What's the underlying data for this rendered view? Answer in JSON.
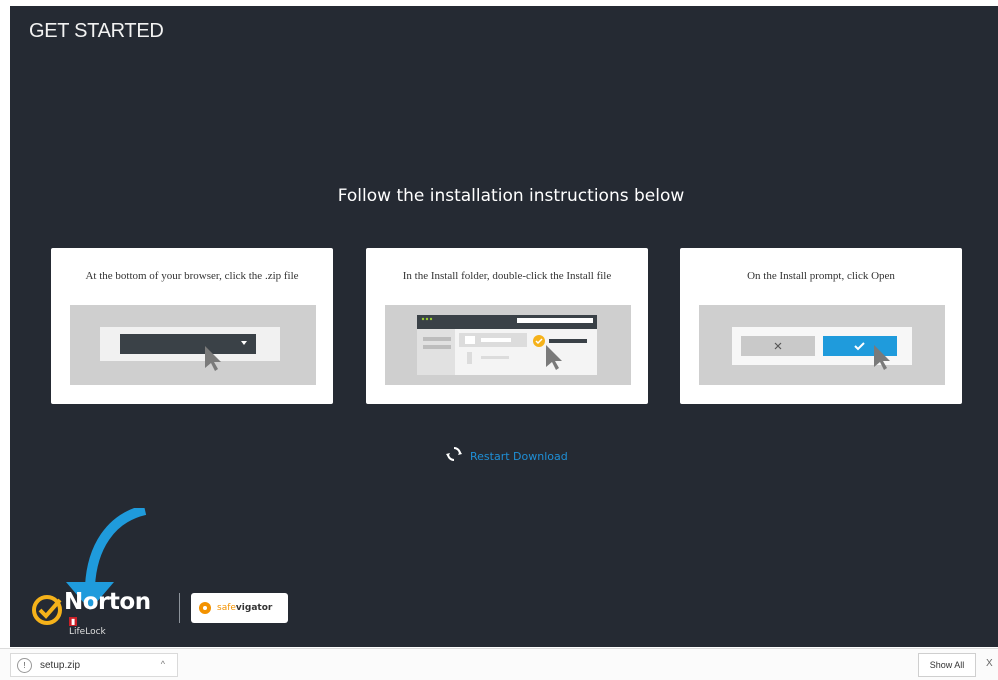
{
  "header": {
    "title": "GET STARTED"
  },
  "main": {
    "headline": "Follow the installation instructions below"
  },
  "steps": [
    {
      "text": "At the bottom of your browser, click the .zip file"
    },
    {
      "text": "In the Install folder, double-click the Install file"
    },
    {
      "text": "On the Install prompt, click Open"
    }
  ],
  "restart": {
    "label": "Restart Download"
  },
  "branding": {
    "norton": "Norton",
    "lifelock": "LifeLock",
    "safeweb": "safe",
    "navigator": "vigator"
  },
  "download_bar": {
    "file_name": "setup.zip",
    "show_all": "Show All",
    "close": "X"
  },
  "colors": {
    "background": "#252a33",
    "accent_blue": "#1f8fd6",
    "card": "#ffffff",
    "norton_yellow": "#f5b21a"
  }
}
